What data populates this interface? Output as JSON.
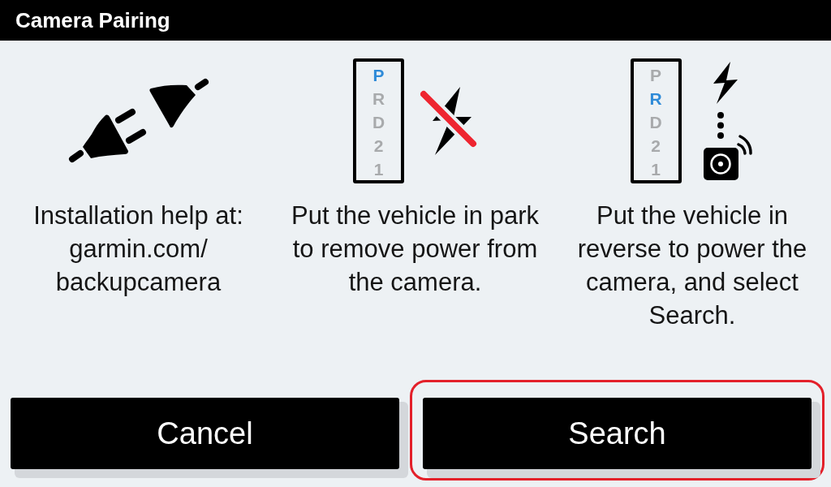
{
  "title": "Camera Pairing",
  "steps": [
    {
      "kind": "unplug",
      "text": "Installation help at: garmin.com/\nbackupcamera"
    },
    {
      "kind": "park",
      "gears": [
        {
          "label": "P",
          "selected": true
        },
        {
          "label": "R",
          "selected": false
        },
        {
          "label": "D",
          "selected": false
        },
        {
          "label": "2",
          "selected": false
        },
        {
          "label": "1",
          "selected": false
        }
      ],
      "text": "Put the vehicle in park to remove power from the camera."
    },
    {
      "kind": "reverse",
      "gears": [
        {
          "label": "P",
          "selected": false
        },
        {
          "label": "R",
          "selected": true
        },
        {
          "label": "D",
          "selected": false
        },
        {
          "label": "2",
          "selected": false
        },
        {
          "label": "1",
          "selected": false
        }
      ],
      "text": "Put the vehicle in reverse to power the camera, and select Search."
    }
  ],
  "buttons": [
    {
      "label": "Cancel",
      "selected": false
    },
    {
      "label": "Search",
      "selected": true
    }
  ]
}
